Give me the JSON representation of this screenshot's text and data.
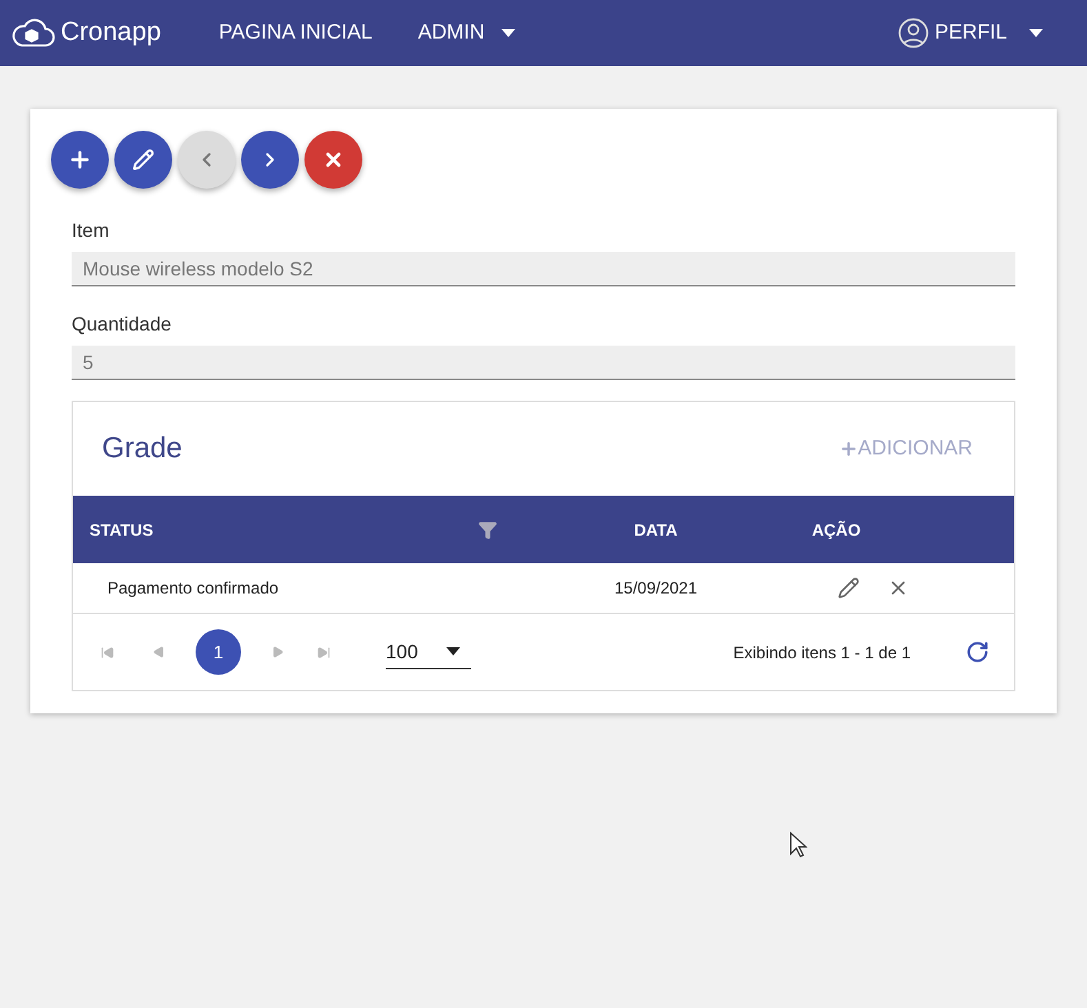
{
  "navbar": {
    "logo": "Cronapp",
    "menu": [
      {
        "label": "PAGINA INICIAL",
        "dropdown": false
      },
      {
        "label": "ADMIN",
        "dropdown": true
      }
    ],
    "profile": {
      "label": "PERFIL",
      "dropdown": true
    }
  },
  "toolbar": [
    {
      "kind": "add",
      "disabled": false
    },
    {
      "kind": "edit",
      "disabled": false
    },
    {
      "kind": "prev",
      "disabled": true
    },
    {
      "kind": "next",
      "disabled": false
    },
    {
      "kind": "delete",
      "disabled": false
    }
  ],
  "fields": [
    {
      "label": "Item",
      "value": "Mouse wireless modelo S2"
    },
    {
      "label": "Quantidade",
      "value": "5"
    }
  ],
  "grid": {
    "title": "Grade",
    "add_button": "ADICIONAR",
    "columns": [
      {
        "label": "STATUS",
        "filter": true
      },
      {
        "label": "DATA",
        "filter": false
      },
      {
        "label": "AÇÃO",
        "filter": false
      }
    ],
    "rows": [
      {
        "status": "Pagamento confirmado",
        "date": "15/09/2021"
      }
    ],
    "pager": {
      "pages": [
        {
          "label": "1",
          "selected": true
        }
      ],
      "page_size": "100",
      "summary": "Exibindo itens 1 - 1 de 1"
    }
  }
}
